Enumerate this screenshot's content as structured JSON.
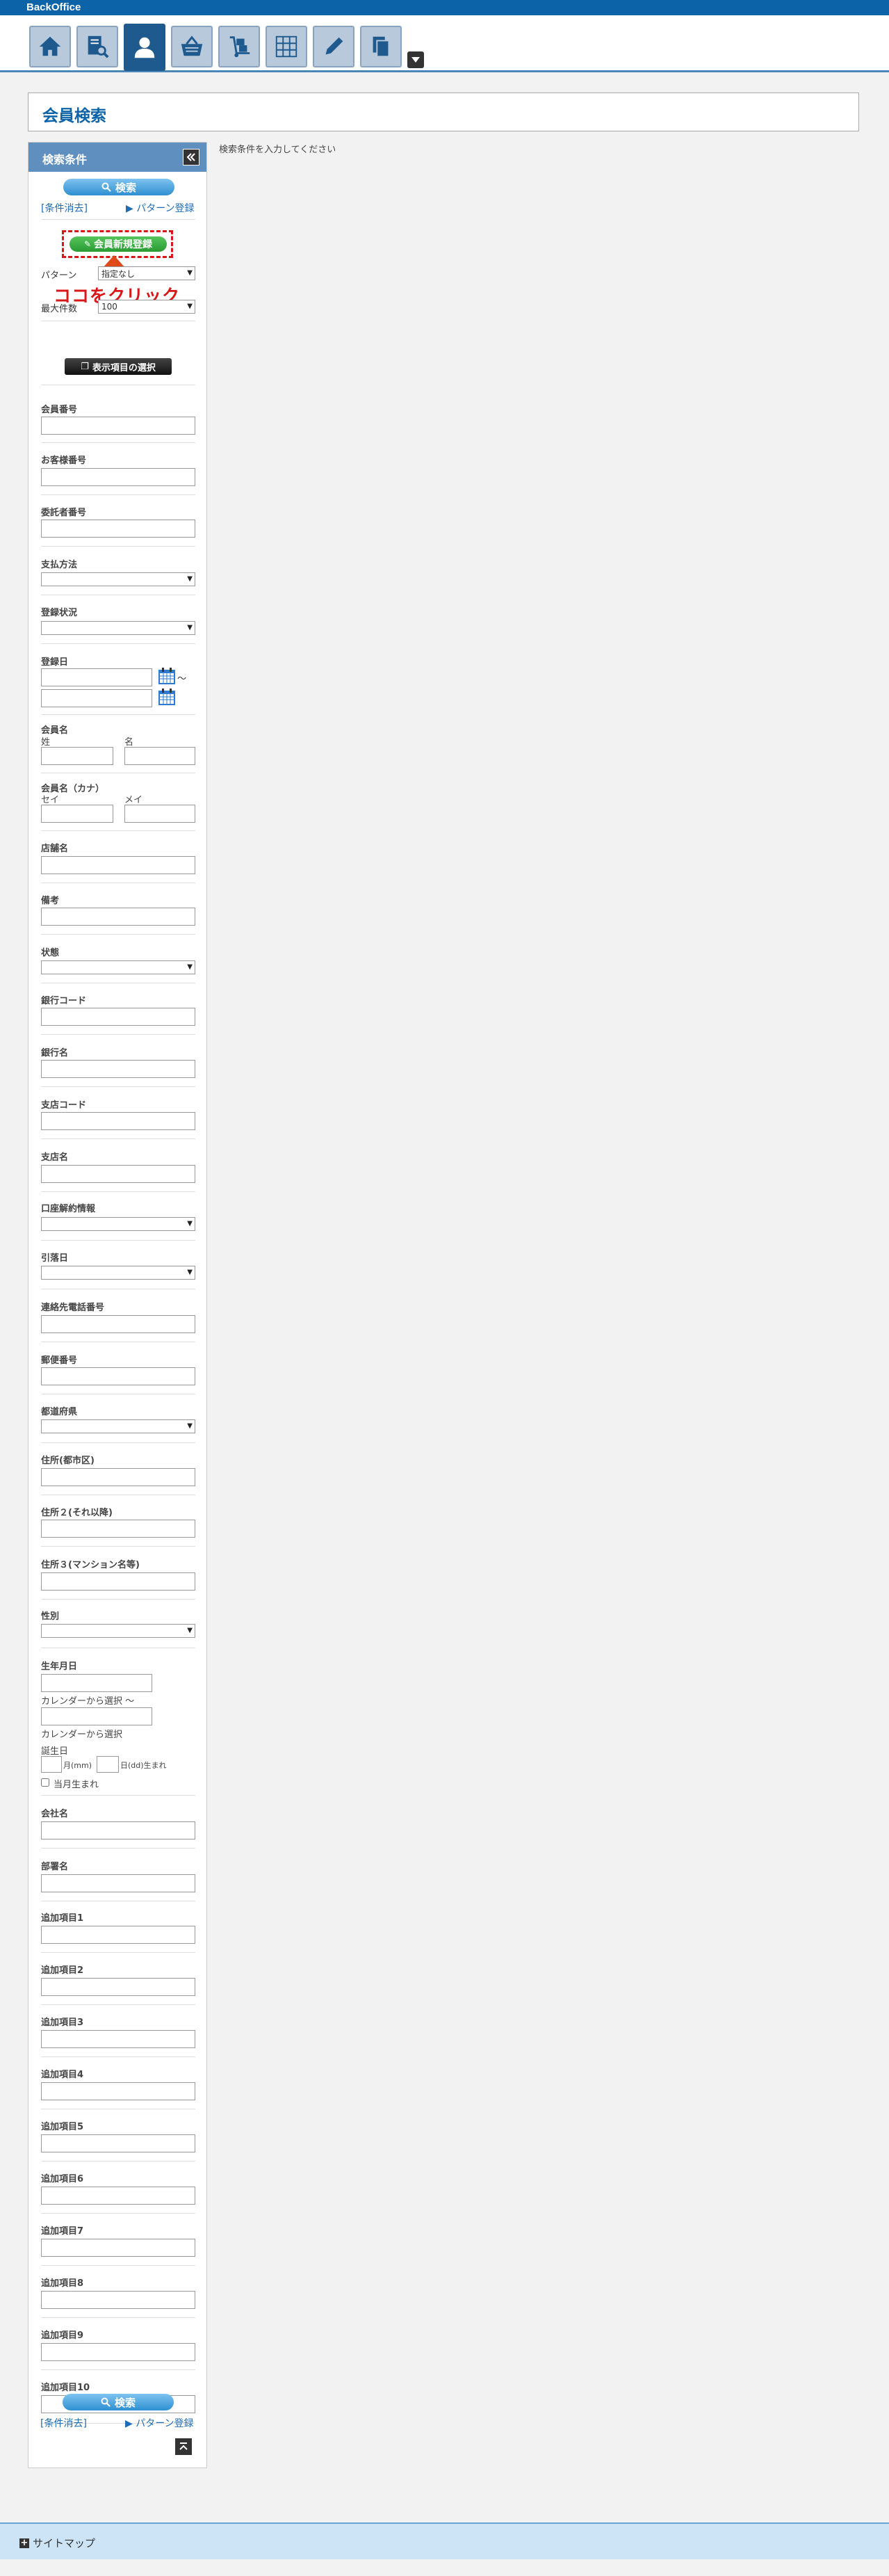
{
  "app": {
    "brand": "BackOffice"
  },
  "page": {
    "title": "会員検索",
    "hint": "検索条件を入力してください"
  },
  "panel": {
    "title": "検索条件",
    "search_label": "検索",
    "clear_label": "[条件消去]",
    "pattern_register_label": "パターン登録",
    "new_member_label": "会員新規登録",
    "click_annotation": "ココをクリック",
    "pattern_label": "パターン",
    "pattern_value": "指定なし",
    "max_count_label": "最大件数",
    "max_count_value": "100",
    "display_items_label": "表示項目の選択"
  },
  "fields": {
    "member_no": "会員番号",
    "customer_no": "お客様番号",
    "consignor_no": "委託者番号",
    "payment_method": "支払方法",
    "registration_status": "登録状況",
    "registration_date": "登録日",
    "range_sep": "～",
    "member_name": "会員名",
    "last": "姓",
    "first": "名",
    "member_kana": "会員名（カナ）",
    "sei": "セイ",
    "mei": "メイ",
    "store_name": "店舗名",
    "remarks": "備考",
    "state": "状態",
    "bank_code": "銀行コード",
    "bank_name": "銀行名",
    "branch_code": "支店コード",
    "branch_name": "支店名",
    "account_cancel": "口座解約情報",
    "withdrawal_date": "引落日",
    "contact_phone": "連絡先電話番号",
    "postal_code": "郵便番号",
    "prefecture": "都道府県",
    "address_city": "住所(都市区)",
    "address_rest": "住所２(それ以降)",
    "address_bldg": "住所３(マンション名等)",
    "gender": "性別",
    "birthdate": "生年月日",
    "cal_alt_1": "カレンダーから選択 ～",
    "cal_alt_2": "カレンダーから選択",
    "birthday": "誕生日",
    "month_unit": "月(mm)",
    "day_unit": "日(dd)生まれ",
    "this_month_born": "当月生まれ",
    "company_name": "会社名",
    "department_name": "部署名",
    "extra1": "追加項目1",
    "extra2": "追加項目2",
    "extra3": "追加項目3",
    "extra4": "追加項目4",
    "extra5": "追加項目5",
    "extra6": "追加項目6",
    "extra7": "追加項目7",
    "extra8": "追加項目8",
    "extra9": "追加項目9",
    "extra10": "追加項目10"
  },
  "footer": {
    "sitemap_label": "サイトマップ"
  }
}
